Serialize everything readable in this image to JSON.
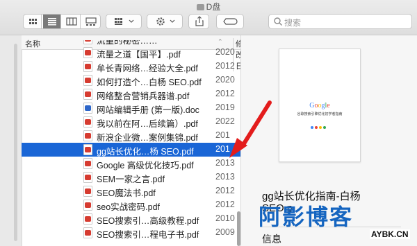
{
  "window": {
    "title": "D盘"
  },
  "toolbar": {
    "search_placeholder": "搜索",
    "icons": [
      "icon-view",
      "list-view",
      "column-view",
      "gallery-view",
      "group-menu",
      "action-menu",
      "share",
      "tag"
    ]
  },
  "list": {
    "header": {
      "name_label": "名称",
      "date_label": "修改日"
    },
    "rows": [
      {
        "name": "流量的秘密……",
        "date": ""
      },
      {
        "name": "流量之道【国平】.pdf",
        "date": "2020"
      },
      {
        "name": "牟长青网络…经验大全.pdf",
        "date": "2012"
      },
      {
        "name": "如何打造个…白杨 SEO.pdf",
        "date": "2020"
      },
      {
        "name": "网络整合营销兵器谱.pdf",
        "date": "2012"
      },
      {
        "name": "网站编辑手册 (第一版).doc",
        "date": "2019",
        "kind": "doc"
      },
      {
        "name": "我以前在阿…后续篇）.pdf",
        "date": "2022"
      },
      {
        "name": "新浪企业微…案例集锦.pdf",
        "date": "201"
      },
      {
        "name": "gg站长优化…杨 SEO.pdf",
        "date": "201",
        "selected": true
      },
      {
        "name": "Google 高级优化技巧.pdf",
        "date": "2013"
      },
      {
        "name": "SEM一家之言.pdf",
        "date": "2013"
      },
      {
        "name": "SEO魔法书.pdf",
        "date": "2012"
      },
      {
        "name": "seo实战密码.pdf",
        "date": "2012"
      },
      {
        "name": "SEO搜索引…高级教程.pdf",
        "date": "2010"
      },
      {
        "name": "SEO搜索引…程电子书.pdf",
        "date": "2009"
      }
    ]
  },
  "preview": {
    "thumb_logo": "Google",
    "thumb_subtitle": "谷歌搜索引擎优化初学者指南",
    "title_line1": "gg站长优化指南-白杨",
    "title_line2": "SEO.p",
    "section_label": "信息"
  },
  "watermark": {
    "text": "阿影博客",
    "site": "AYBK.CN"
  },
  "colors": {
    "selection": "#1a66d6",
    "arrow": "#e31c1c",
    "watermark": "#1565c0",
    "pdf_icon": "#d63b30",
    "doc_icon": "#2d66c9"
  }
}
